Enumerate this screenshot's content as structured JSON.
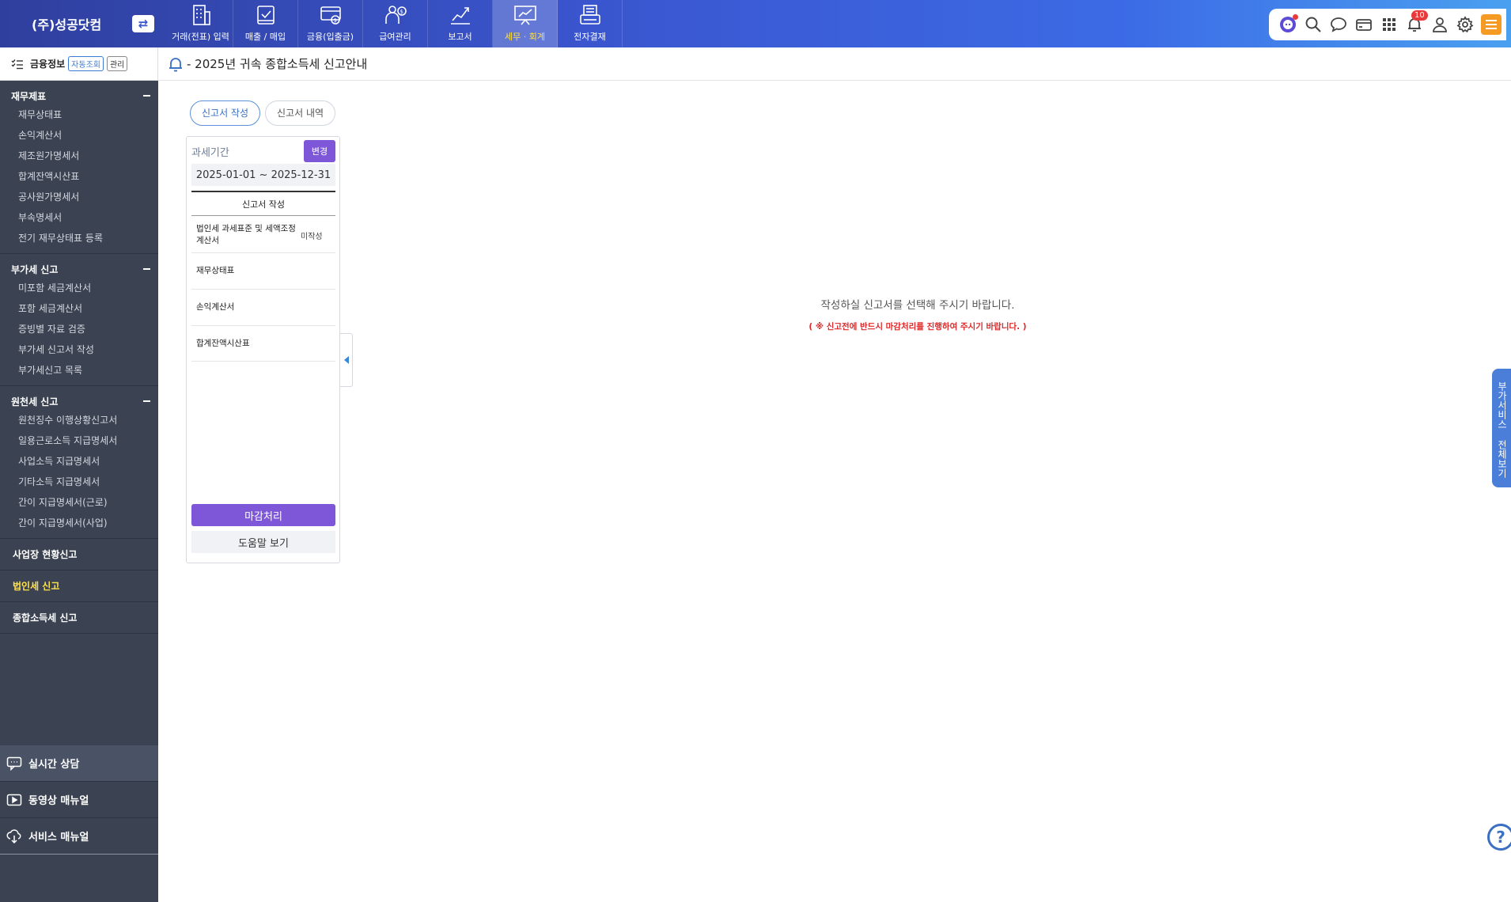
{
  "header": {
    "company": "(주)성공닷컴",
    "switch_icon": "⇄",
    "menu": [
      {
        "label": "거래(전표) 입력",
        "icon": "building-icon",
        "active": false
      },
      {
        "label": "매출 / 매입",
        "icon": "receipt-icon",
        "active": false
      },
      {
        "label": "금융(입출금)",
        "icon": "bank-icon",
        "active": false
      },
      {
        "label": "급여관리",
        "icon": "payroll-icon",
        "active": false
      },
      {
        "label": "보고서",
        "icon": "chart-icon",
        "active": false
      },
      {
        "label": "세무 · 회계",
        "icon": "presentation-icon",
        "active": true
      },
      {
        "label": "전자결재",
        "icon": "approval-icon",
        "active": false
      }
    ],
    "tools": {
      "notification_count": "10"
    }
  },
  "sidebar": {
    "finance_label": "금융정보",
    "auto_chip": "자동조회",
    "manage_chip": "관리",
    "groups": [
      {
        "title": "재무제표",
        "items": [
          "재무상태표",
          "손익계산서",
          "제조원가명세서",
          "합계잔액시산표",
          "공사원가명세서",
          "부속명세서",
          "전기 재무상태표 등록"
        ]
      },
      {
        "title": "부가세 신고",
        "items": [
          "미포함 세금계산서",
          "포함 세금계산서",
          "증빙별 자료 검증",
          "부가세 신고서 작성",
          "부가세신고 목록"
        ]
      },
      {
        "title": "원천세 신고",
        "items": [
          "원천징수 이행상황신고서",
          "일용근로소득 지급명세서",
          "사업소득 지급명세서",
          "기타소득 지급명세서",
          "간이 지급명세서(근로)",
          "간이 지급명세서(사업)"
        ]
      }
    ],
    "singles": [
      {
        "label": "사업장 현황신고",
        "active": false
      },
      {
        "label": "법인세 신고",
        "active": true
      },
      {
        "label": "종합소득세 신고",
        "active": false
      }
    ],
    "bottom": [
      "실시간 상담",
      "동영상 매뉴얼",
      "서비스 매뉴얼"
    ]
  },
  "page": {
    "title": "- 2025년 귀속 종합소득세 신고안내",
    "tabs": [
      "신고서 작성",
      "신고서 내역"
    ],
    "period_label": "과세기간",
    "change_label": "변경",
    "period_value": "2025-01-01 ~ 2025-12-31",
    "list_header": "신고서 작성",
    "reports": [
      {
        "name": "법인세 과세표준 및 세액조정계산서",
        "status": "미작성"
      },
      {
        "name": "재무상태표",
        "status": ""
      },
      {
        "name": "손익계산서",
        "status": ""
      },
      {
        "name": "합계잔액시산표",
        "status": ""
      }
    ],
    "close_label": "마감처리",
    "help_label": "도움말 보기",
    "empty_message": "작성하실 신고서를 선택해 주시기 바랍니다.",
    "empty_warning": "( ※ 신고전에 반드시 마감처리를 진행하여 주시기 바랍니다. )",
    "side_tab": "부가서비스 전체보기",
    "help_fab": "?"
  },
  "colors": {
    "accent_purple": "#7e57d9",
    "sidebar_bg": "#3b4352",
    "active_menu_text": "#ffe14a",
    "warning_red": "#e02828"
  }
}
